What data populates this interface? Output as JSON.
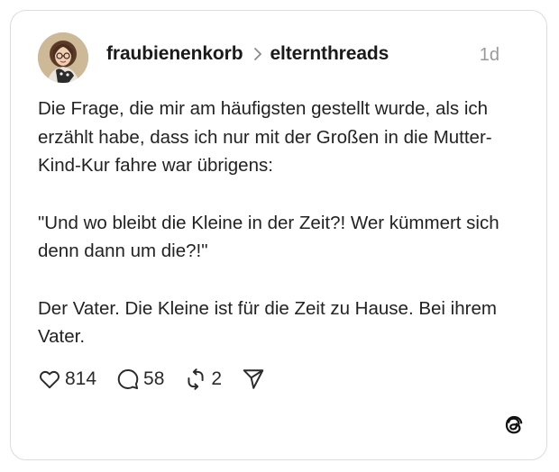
{
  "post": {
    "author": "fraubienenkorb",
    "community": "elternthreads",
    "time": "1d",
    "paragraphs": {
      "p1": "Die Frage, die mir am häufigsten gestellt wurde, als ich erzählt habe, dass ich nur mit der Großen in die Mutter-Kind-Kur fahre war übrigens:",
      "p2": "\"Und wo bleibt die Kleine in der Zeit?! Wer kümmert sich denn dann um die?!\"",
      "p3": "Der Vater. Die Kleine ist für die Zeit zu Hause. Bei ihrem Vater."
    },
    "likes": "814",
    "comments": "58",
    "reposts": "2"
  },
  "icons": {
    "separator": "chevron-right-icon",
    "like": "heart-icon",
    "comment": "comment-bubble-icon",
    "repost": "repost-icon",
    "share": "send-icon",
    "brand": "threads-logo-icon"
  },
  "colors": {
    "text": "#1f1f1f",
    "muted": "#9a9a9a",
    "border": "#dcdcdc"
  }
}
